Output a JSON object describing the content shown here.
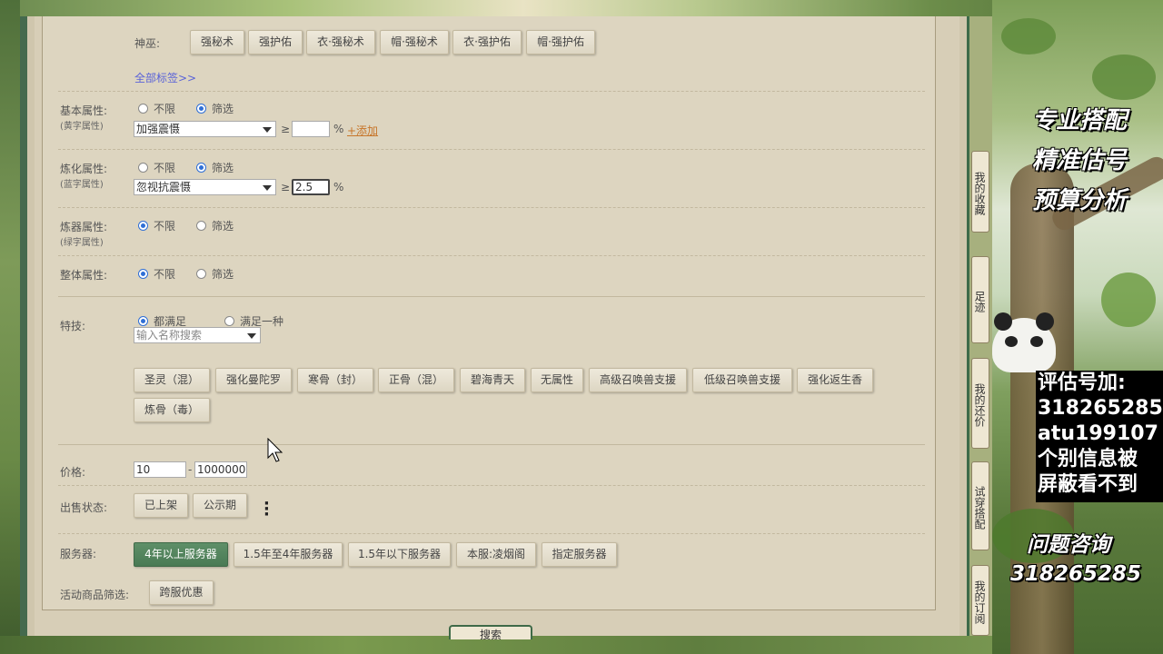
{
  "shaman_row": {
    "label": "神巫:",
    "tags": [
      "强秘术",
      "强护佑",
      "衣·强秘术",
      "帽·强秘术",
      "衣·强护佑",
      "帽·强护佑"
    ]
  },
  "all_tags_link": "全部标签>>",
  "basic_attr": {
    "label": "基本属性:",
    "sub": "(黄字属性)",
    "opt_any": "不限",
    "opt_filter": "筛选",
    "select_value": "加强震慑",
    "op": "≥",
    "value": "",
    "unit": "%",
    "add_link": "+添加"
  },
  "refine_attr": {
    "label": "炼化属性:",
    "sub": "(蓝字属性)",
    "opt_any": "不限",
    "opt_filter": "筛选",
    "select_value": "忽视抗震慑",
    "op": "≥",
    "value": "2.5",
    "unit": "%"
  },
  "forge_attr": {
    "label": "炼器属性:",
    "sub": "(绿字属性)",
    "opt_any": "不限",
    "opt_filter": "筛选"
  },
  "overall_attr": {
    "label": "整体属性:",
    "opt_any": "不限",
    "opt_filter": "筛选"
  },
  "skills": {
    "label": "特技:",
    "opt_all": "都满足",
    "opt_one": "满足一种",
    "search_placeholder": "输入名称搜索",
    "buttons": [
      "圣灵（混）",
      "强化曼陀罗",
      "寒骨（封）",
      "正骨（混）",
      "碧海青天",
      "无属性",
      "高级召唤兽支援",
      "低级召唤兽支援",
      "强化返生香",
      "炼骨（毒）"
    ]
  },
  "price": {
    "label": "价格:",
    "min": "10",
    "sep": "-",
    "max": "1000000"
  },
  "sale_status": {
    "label": "出售状态:",
    "buttons": [
      "已上架",
      "公示期"
    ]
  },
  "server": {
    "label": "服务器:",
    "buttons": [
      "4年以上服务器",
      "1.5年至4年服务器",
      "1.5年以下服务器",
      "本服:凌烟阁",
      "指定服务器"
    ]
  },
  "activity": {
    "label": "活动商品筛选:",
    "button": "跨服优惠"
  },
  "search_button": "搜索",
  "side_tabs": [
    "我的收藏",
    "足迹",
    "我的还价",
    "试穿搭配",
    "我的订阅"
  ],
  "promo": {
    "line1": "专业搭配",
    "line2": "精准估号",
    "line3": "预算分析",
    "contact_lines": [
      "评估号加:",
      "318265285",
      "atu199107",
      "个别信息被",
      "屏蔽看不到"
    ],
    "consult": "问题咨询",
    "consult_qq": "318265285"
  },
  "colors": {
    "active_button": "#497a54",
    "link": "#5a63d8",
    "add_link": "#c7762a",
    "panel": "#ddd5c0"
  }
}
